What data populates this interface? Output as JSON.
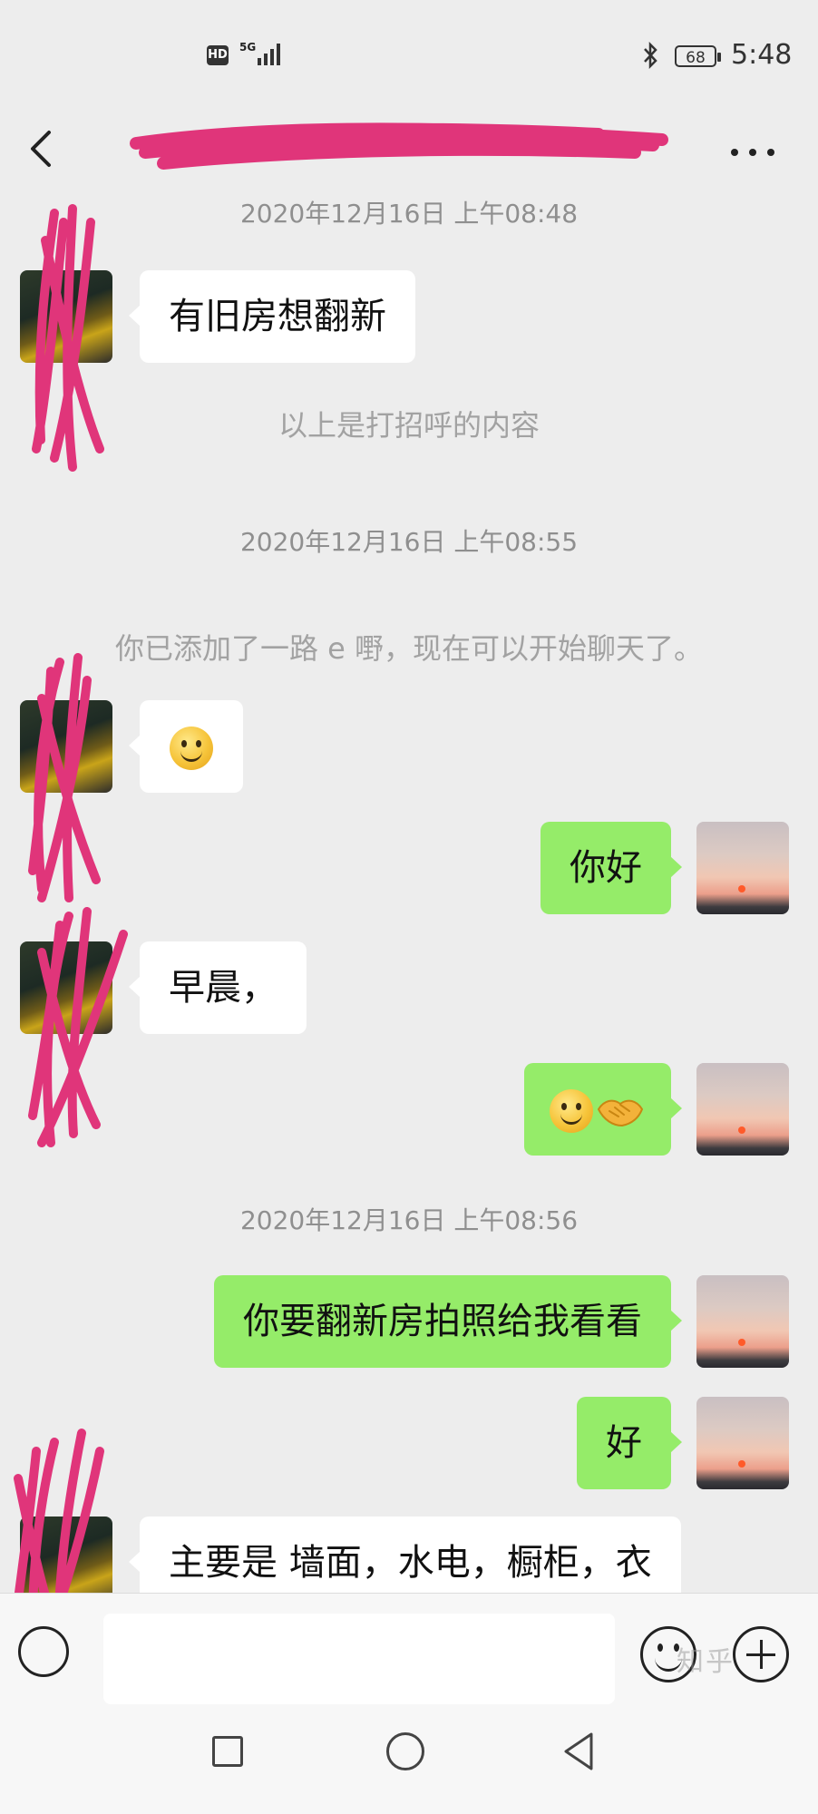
{
  "status_bar": {
    "hd": "HD",
    "network": "5G",
    "battery": "68",
    "time": "5:48"
  },
  "header": {
    "title": ""
  },
  "messages": [
    {
      "type": "timestamp",
      "text": "2020年12月16日 上午08:48"
    },
    {
      "type": "incoming",
      "text": "有旧房想翻新"
    },
    {
      "type": "system",
      "text": "以上是打招呼的内容"
    },
    {
      "type": "timestamp",
      "text": "2020年12月16日 上午08:55"
    },
    {
      "type": "system",
      "text": "你已添加了一路 e 嘢，现在可以开始聊天了。"
    },
    {
      "type": "incoming",
      "emoji": "smile-emoji"
    },
    {
      "type": "outgoing",
      "text": "你好"
    },
    {
      "type": "incoming",
      "text": "早晨，"
    },
    {
      "type": "outgoing",
      "emoji": "smile-handshake-emoji"
    },
    {
      "type": "timestamp",
      "text": "2020年12月16日 上午08:56"
    },
    {
      "type": "outgoing",
      "text": "你要翻新房拍照给我看看"
    },
    {
      "type": "outgoing",
      "text": "好"
    },
    {
      "type": "incoming",
      "text": "主要是 墙面，水电，橱柜，衣"
    }
  ],
  "input": {
    "value": "",
    "watermark": "知乎"
  },
  "icons": {
    "back": "back-arrow-icon",
    "more": "more-dots-icon",
    "voice": "voice-icon",
    "emoji": "emoji-icon",
    "plus": "plus-icon",
    "nav_recents": "square-icon",
    "nav_home": "circle-icon",
    "nav_back": "triangle-back-icon"
  },
  "colors": {
    "background": "#ededed",
    "outgoing_bubble": "#95ec69",
    "incoming_bubble": "#ffffff",
    "redaction": "#e0357a"
  }
}
